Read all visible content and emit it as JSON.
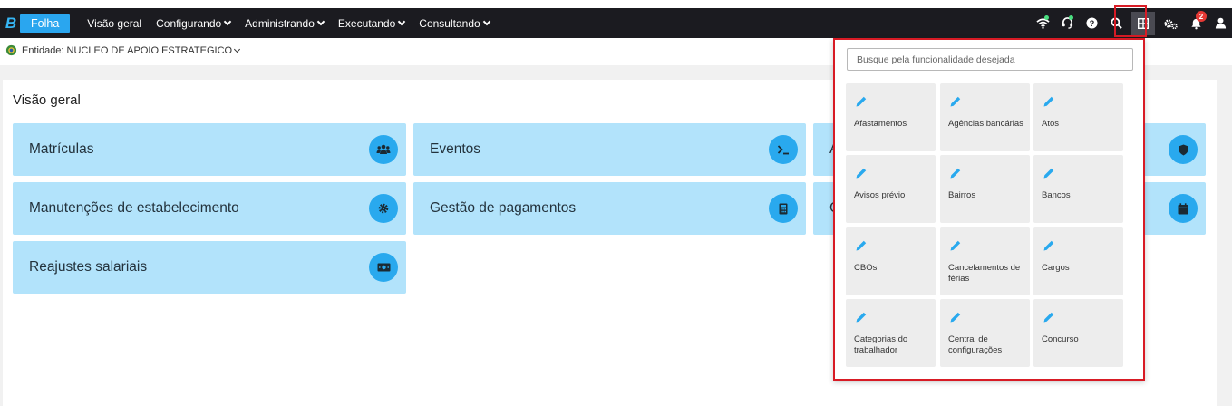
{
  "app": {
    "name": "Folha"
  },
  "nav": [
    {
      "label": "Visão geral",
      "caret": false
    },
    {
      "label": "Configurando",
      "caret": true
    },
    {
      "label": "Administrando",
      "caret": true
    },
    {
      "label": "Executando",
      "caret": true
    },
    {
      "label": "Consultando",
      "caret": true
    }
  ],
  "header": {
    "notifications_count": "2"
  },
  "entity": {
    "label": "Entidade: NUCLEO DE APOIO ESTRATEGICO"
  },
  "page": {
    "title": "Visão geral"
  },
  "cards": [
    {
      "label": "Matrículas",
      "icon": "users-icon"
    },
    {
      "label": "Eventos",
      "icon": "terminal-icon"
    },
    {
      "label": "A",
      "icon": "shield-icon"
    },
    {
      "label": "Manutenções de estabelecimento",
      "icon": "gear-icon"
    },
    {
      "label": "Gestão de pagamentos",
      "icon": "calculator-icon"
    },
    {
      "label": "C",
      "icon": "calendar-icon"
    },
    {
      "label": "Reajustes salariais",
      "icon": "money-icon"
    }
  ],
  "apps_menu": {
    "search_placeholder": "Busque pela funcionalidade desejada",
    "items": [
      {
        "label": "Afastamentos"
      },
      {
        "label": "Agências bancárias"
      },
      {
        "label": "Atos"
      },
      {
        "label": "Avisos prévio"
      },
      {
        "label": "Bairros"
      },
      {
        "label": "Bancos"
      },
      {
        "label": "CBOs"
      },
      {
        "label": "Cancelamentos de férias"
      },
      {
        "label": "Cargos"
      },
      {
        "label": "Categorias do trabalhador"
      },
      {
        "label": "Central de configurações"
      },
      {
        "label": "Concurso"
      }
    ]
  },
  "colors": {
    "accent": "#29a9ee",
    "card_bg": "#b2e3fb",
    "topbar": "#1b1b20",
    "highlight": "#d81b25"
  }
}
